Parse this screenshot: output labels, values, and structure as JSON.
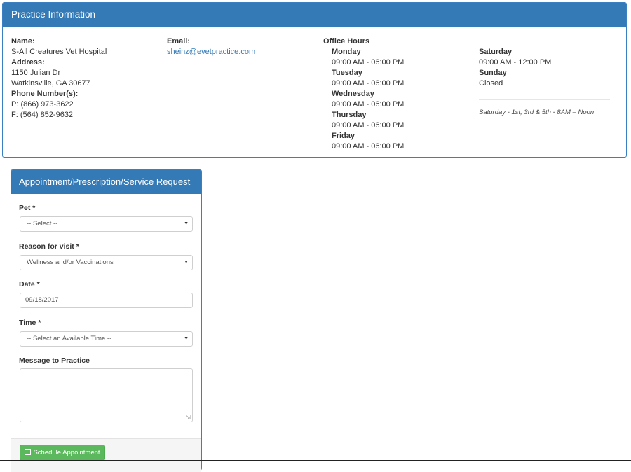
{
  "practice": {
    "heading": "Practice Information",
    "name_label": "Name:",
    "name": "S-All Creatures Vet Hospital",
    "address_label": "Address:",
    "address_line1": "1150 Julian Dr",
    "address_line2": "Watkinsville, GA 30677",
    "phone_label": "Phone Number(s):",
    "phone": "P: (866) 973-3622",
    "fax": "F: (564) 852-9632",
    "email_label": "Email:",
    "email": "sheinz@evetpractice.com",
    "hours_label": "Office Hours",
    "hours": [
      {
        "day": "Monday",
        "time": "09:00 AM - 06:00 PM"
      },
      {
        "day": "Tuesday",
        "time": "09:00 AM - 06:00 PM"
      },
      {
        "day": "Wednesday",
        "time": "09:00 AM - 06:00 PM"
      },
      {
        "day": "Thursday",
        "time": "09:00 AM - 06:00 PM"
      },
      {
        "day": "Friday",
        "time": "09:00 AM - 06:00 PM"
      },
      {
        "day": "Saturday",
        "time": "09:00 AM - 12:00 PM"
      },
      {
        "day": "Sunday",
        "time": "Closed"
      }
    ],
    "hours_note": "Saturday - 1st, 3rd & 5th - 8AM – Noon"
  },
  "form": {
    "heading": "Appointment/Prescription/Service Request",
    "pet_label": "Pet *",
    "pet_value": "-- Select --",
    "reason_label": "Reason for visit *",
    "reason_value": "Wellness and/or Vaccinations",
    "date_label": "Date *",
    "date_value": "09/18/2017",
    "time_label": "Time *",
    "time_value": "-- Select an Available Time --",
    "message_label": "Message to Practice",
    "message_value": "",
    "submit_label": "Schedule Appointment"
  },
  "icons": {
    "dropdown": "chevron-down-icon",
    "submit": "floppy-disk-icon",
    "resize": "resize-handle-icon"
  },
  "colors": {
    "primary": "#337ab7",
    "success": "#5cb85c"
  }
}
